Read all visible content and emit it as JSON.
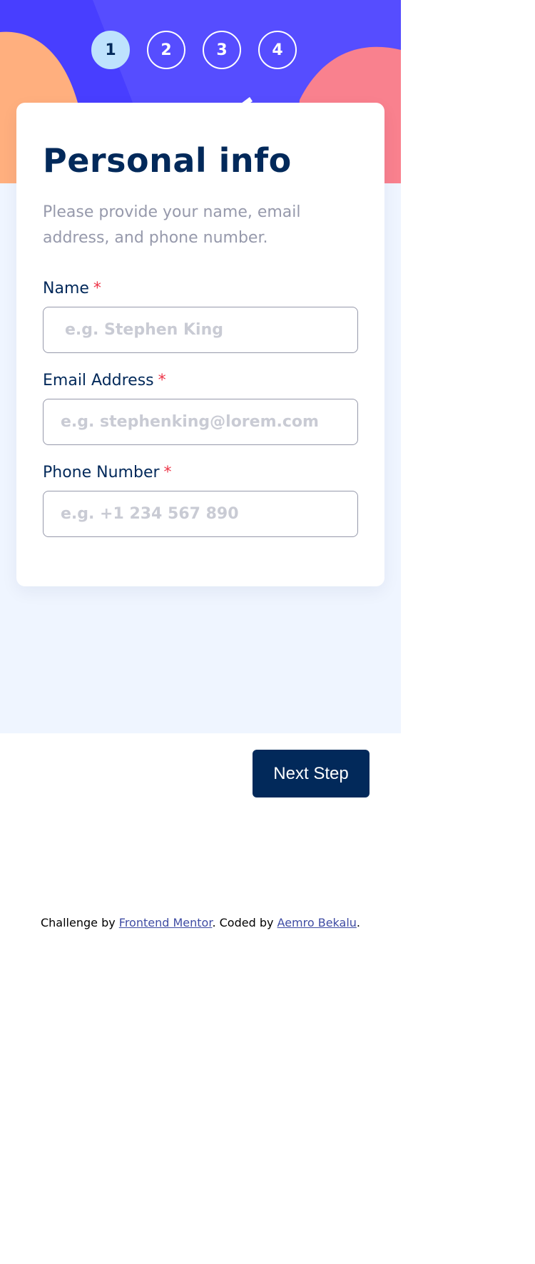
{
  "steps": [
    "1",
    "2",
    "3",
    "4"
  ],
  "active_step": 1,
  "form": {
    "title": "Personal info",
    "description": "Please provide your name, email address, and phone number.",
    "fields": [
      {
        "label": "Name",
        "required_mark": "*",
        "placeholder": "e.g. Stephen King",
        "value": ""
      },
      {
        "label": "Email Address",
        "required_mark": "*",
        "placeholder": "e.g. stephenking@lorem.com",
        "value": ""
      },
      {
        "label": "Phone Number",
        "required_mark": "*",
        "placeholder": "e.g. +1 234 567 890",
        "value": ""
      }
    ]
  },
  "nav": {
    "next_label": "Next Step"
  },
  "footer": {
    "prefix": "Challenge by ",
    "link1": "Frontend Mentor",
    "middle": ". Coded by ",
    "link2": "Aemro Bekalu",
    "suffix": "."
  },
  "colors": {
    "header_bg": "#483eff",
    "accent_orange": "#ffaf7e",
    "accent_pink": "#f9818e",
    "step_active": "#bee2fd",
    "marine_blue": "#02295a",
    "required": "#ed3548",
    "page_bg": "#eff5ff"
  }
}
